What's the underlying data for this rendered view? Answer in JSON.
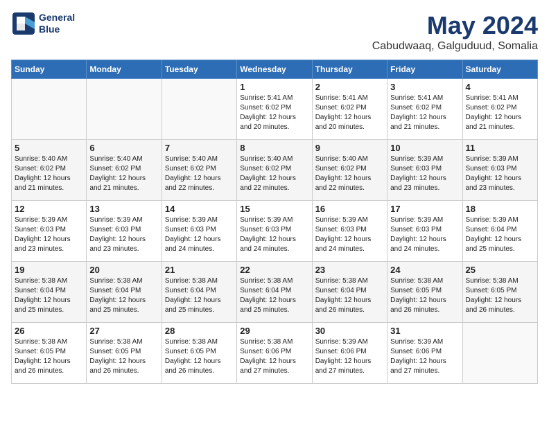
{
  "header": {
    "logo_line1": "General",
    "logo_line2": "Blue",
    "month": "May 2024",
    "location": "Cabudwaaq, Galguduud, Somalia"
  },
  "weekdays": [
    "Sunday",
    "Monday",
    "Tuesday",
    "Wednesday",
    "Thursday",
    "Friday",
    "Saturday"
  ],
  "weeks": [
    [
      {
        "day": "",
        "info": ""
      },
      {
        "day": "",
        "info": ""
      },
      {
        "day": "",
        "info": ""
      },
      {
        "day": "1",
        "info": "Sunrise: 5:41 AM\nSunset: 6:02 PM\nDaylight: 12 hours\nand 20 minutes."
      },
      {
        "day": "2",
        "info": "Sunrise: 5:41 AM\nSunset: 6:02 PM\nDaylight: 12 hours\nand 20 minutes."
      },
      {
        "day": "3",
        "info": "Sunrise: 5:41 AM\nSunset: 6:02 PM\nDaylight: 12 hours\nand 21 minutes."
      },
      {
        "day": "4",
        "info": "Sunrise: 5:41 AM\nSunset: 6:02 PM\nDaylight: 12 hours\nand 21 minutes."
      }
    ],
    [
      {
        "day": "5",
        "info": "Sunrise: 5:40 AM\nSunset: 6:02 PM\nDaylight: 12 hours\nand 21 minutes."
      },
      {
        "day": "6",
        "info": "Sunrise: 5:40 AM\nSunset: 6:02 PM\nDaylight: 12 hours\nand 21 minutes."
      },
      {
        "day": "7",
        "info": "Sunrise: 5:40 AM\nSunset: 6:02 PM\nDaylight: 12 hours\nand 22 minutes."
      },
      {
        "day": "8",
        "info": "Sunrise: 5:40 AM\nSunset: 6:02 PM\nDaylight: 12 hours\nand 22 minutes."
      },
      {
        "day": "9",
        "info": "Sunrise: 5:40 AM\nSunset: 6:02 PM\nDaylight: 12 hours\nand 22 minutes."
      },
      {
        "day": "10",
        "info": "Sunrise: 5:39 AM\nSunset: 6:03 PM\nDaylight: 12 hours\nand 23 minutes."
      },
      {
        "day": "11",
        "info": "Sunrise: 5:39 AM\nSunset: 6:03 PM\nDaylight: 12 hours\nand 23 minutes."
      }
    ],
    [
      {
        "day": "12",
        "info": "Sunrise: 5:39 AM\nSunset: 6:03 PM\nDaylight: 12 hours\nand 23 minutes."
      },
      {
        "day": "13",
        "info": "Sunrise: 5:39 AM\nSunset: 6:03 PM\nDaylight: 12 hours\nand 23 minutes."
      },
      {
        "day": "14",
        "info": "Sunrise: 5:39 AM\nSunset: 6:03 PM\nDaylight: 12 hours\nand 24 minutes."
      },
      {
        "day": "15",
        "info": "Sunrise: 5:39 AM\nSunset: 6:03 PM\nDaylight: 12 hours\nand 24 minutes."
      },
      {
        "day": "16",
        "info": "Sunrise: 5:39 AM\nSunset: 6:03 PM\nDaylight: 12 hours\nand 24 minutes."
      },
      {
        "day": "17",
        "info": "Sunrise: 5:39 AM\nSunset: 6:03 PM\nDaylight: 12 hours\nand 24 minutes."
      },
      {
        "day": "18",
        "info": "Sunrise: 5:39 AM\nSunset: 6:04 PM\nDaylight: 12 hours\nand 25 minutes."
      }
    ],
    [
      {
        "day": "19",
        "info": "Sunrise: 5:38 AM\nSunset: 6:04 PM\nDaylight: 12 hours\nand 25 minutes."
      },
      {
        "day": "20",
        "info": "Sunrise: 5:38 AM\nSunset: 6:04 PM\nDaylight: 12 hours\nand 25 minutes."
      },
      {
        "day": "21",
        "info": "Sunrise: 5:38 AM\nSunset: 6:04 PM\nDaylight: 12 hours\nand 25 minutes."
      },
      {
        "day": "22",
        "info": "Sunrise: 5:38 AM\nSunset: 6:04 PM\nDaylight: 12 hours\nand 25 minutes."
      },
      {
        "day": "23",
        "info": "Sunrise: 5:38 AM\nSunset: 6:04 PM\nDaylight: 12 hours\nand 26 minutes."
      },
      {
        "day": "24",
        "info": "Sunrise: 5:38 AM\nSunset: 6:05 PM\nDaylight: 12 hours\nand 26 minutes."
      },
      {
        "day": "25",
        "info": "Sunrise: 5:38 AM\nSunset: 6:05 PM\nDaylight: 12 hours\nand 26 minutes."
      }
    ],
    [
      {
        "day": "26",
        "info": "Sunrise: 5:38 AM\nSunset: 6:05 PM\nDaylight: 12 hours\nand 26 minutes."
      },
      {
        "day": "27",
        "info": "Sunrise: 5:38 AM\nSunset: 6:05 PM\nDaylight: 12 hours\nand 26 minutes."
      },
      {
        "day": "28",
        "info": "Sunrise: 5:38 AM\nSunset: 6:05 PM\nDaylight: 12 hours\nand 26 minutes."
      },
      {
        "day": "29",
        "info": "Sunrise: 5:38 AM\nSunset: 6:06 PM\nDaylight: 12 hours\nand 27 minutes."
      },
      {
        "day": "30",
        "info": "Sunrise: 5:39 AM\nSunset: 6:06 PM\nDaylight: 12 hours\nand 27 minutes."
      },
      {
        "day": "31",
        "info": "Sunrise: 5:39 AM\nSunset: 6:06 PM\nDaylight: 12 hours\nand 27 minutes."
      },
      {
        "day": "",
        "info": ""
      }
    ]
  ]
}
